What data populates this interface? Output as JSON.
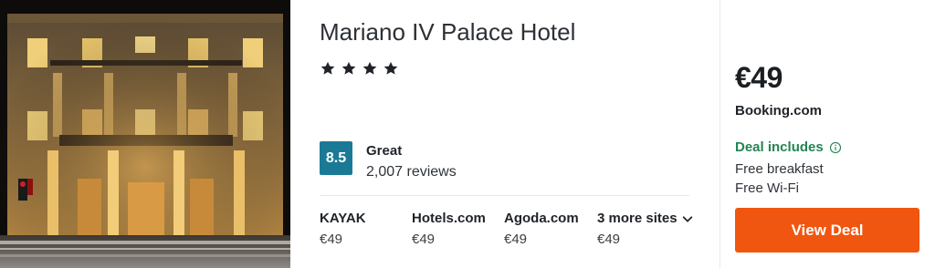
{
  "hotel": {
    "name": "Mariano IV Palace Hotel",
    "star_count": 4,
    "photo_icon": "hotel-photo"
  },
  "rating": {
    "score": "8.5",
    "label": "Great",
    "reviews": "2,007 reviews",
    "badge_color": "#1a7a96"
  },
  "sites": [
    {
      "name": "KAYAK",
      "price": "€49"
    },
    {
      "name": "Hotels.com",
      "price": "€49"
    },
    {
      "name": "Agoda.com",
      "price": "€49"
    },
    {
      "name": "3 more sites",
      "price": "€49",
      "icon": "chevron-down-icon"
    }
  ],
  "deal": {
    "price": "€49",
    "provider": "Booking.com",
    "includes_label": "Deal includes",
    "includes_icon": "info-icon",
    "includes_color": "#238552",
    "items": [
      "Free breakfast",
      "Free Wi-Fi"
    ],
    "button_label": "View Deal",
    "button_color": "#f0560f"
  }
}
